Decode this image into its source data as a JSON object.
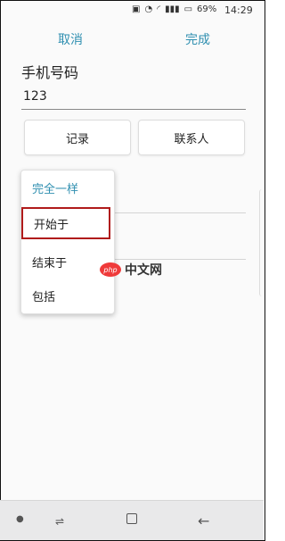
{
  "status_bar": {
    "battery": "69%",
    "time": "14:29"
  },
  "header": {
    "cancel": "取消",
    "done": "完成"
  },
  "form": {
    "title": "手机号码",
    "value": "123"
  },
  "buttons": {
    "record": "记录",
    "contacts": "联系人"
  },
  "menu": {
    "items": [
      "完全一样",
      "开始于",
      "结束于",
      "包括"
    ],
    "selected": "开始于"
  },
  "watermark": {
    "text": "中文网",
    "logo": "php"
  }
}
